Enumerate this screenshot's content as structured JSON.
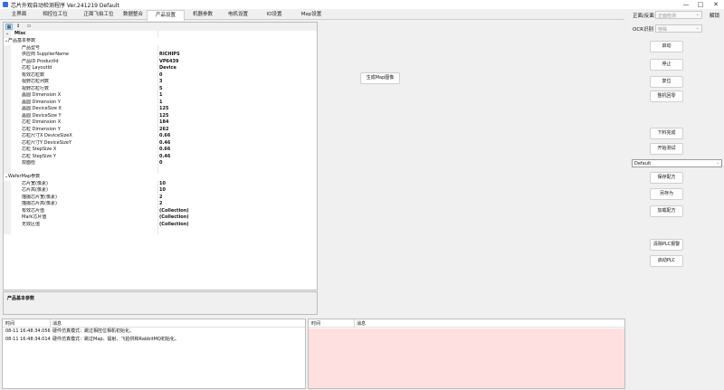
{
  "window": {
    "title": "芯片外观自动检测程序 Ver.241219 Default",
    "controls": [
      "—",
      "□",
      "✕"
    ]
  },
  "tabs": [
    "主界面",
    "相控位工位",
    "正面飞拍工位",
    "数据整合",
    "产品设置",
    "机器参数",
    "电机设置",
    "IO设置",
    "Map设置"
  ],
  "active_tab": "产品设置",
  "right_panel": {
    "mode_label": "正面/反面",
    "mode_value": "正面检测",
    "ocr_label": "OCR识别",
    "ocr_value": "特殊",
    "lock_label": "解锁",
    "buttons_top": [
      "启动",
      "停止",
      "复位",
      "整机回零"
    ],
    "buttons_mid": [
      "下料完成",
      "开始测试"
    ],
    "recipe_value": "Default",
    "buttons_recipe": [
      "保存配方",
      "另存为",
      "加载配方"
    ],
    "buttons_plc": [
      "清除PLC报警",
      "启动PLC"
    ]
  },
  "grid": {
    "toolbar": [
      "categorized-icon",
      "alphabetical-icon",
      "property-pages-icon"
    ],
    "root": "Misc",
    "sections": [
      {
        "title": "产品基本参数",
        "rows": [
          {
            "name": "产品型号",
            "value": ""
          },
          {
            "name": "供应商 SupplierName",
            "value": "RICHIPS"
          },
          {
            "name": "产品ID ProductId",
            "value": "VP6439"
          },
          {
            "name": "芯粒 LayoutId",
            "value": "Device"
          },
          {
            "name": "有效芯粒数",
            "value": "0"
          },
          {
            "name": "视野芯粒列数",
            "value": "3"
          },
          {
            "name": "视野芯粒行数",
            "value": "5"
          },
          {
            "name": "晶圆 Dimension X",
            "value": "1"
          },
          {
            "name": "晶圆 Dimension Y",
            "value": "1"
          },
          {
            "name": "晶圆 DeviceSize X",
            "value": "125"
          },
          {
            "name": "晶圆 DeviceSize Y",
            "value": "125"
          },
          {
            "name": "芯粒 Dimension X",
            "value": "184"
          },
          {
            "name": "芯粒 Dimension Y",
            "value": "262"
          },
          {
            "name": "芯粒尺寸X DeviceSizeX",
            "value": "0.66"
          },
          {
            "name": "芯粒尺寸Y DeviceSizeY",
            "value": "0.46"
          },
          {
            "name": "芯粒 StepSize X",
            "value": "0.66"
          },
          {
            "name": "芯粒 StepSize Y",
            "value": "0.46"
          },
          {
            "name": "双面检",
            "value": "0"
          }
        ]
      },
      {
        "title": "WaferMap参数",
        "rows": [
          {
            "name": "芯片宽(像素)",
            "value": "10"
          },
          {
            "name": "芯片高(像素)",
            "value": "10"
          },
          {
            "name": "描摄芯片宽(像素)",
            "value": "2"
          },
          {
            "name": "描摄芯片高(像素)",
            "value": "2"
          },
          {
            "name": "有效芯片值",
            "value": "(Collection)"
          },
          {
            "name": "Mark芯片值",
            "value": "(Collection)"
          },
          {
            "name": "无效区值",
            "value": "(Collection)"
          }
        ]
      }
    ],
    "help_title": "产品基本参数"
  },
  "center_button": "生成Map图像",
  "log_left": {
    "headers": [
      "时间",
      "消息"
    ],
    "rows": [
      {
        "time": "08-11 16:48:34.056",
        "msg": "硬件仿真模式：跳过相控位相机初始化。"
      },
      {
        "time": "08-11 16:48:34.014",
        "msg": "硬件仿真模式：跳过Map、镭射、飞拍供和RabbitMQ初始化。"
      }
    ]
  },
  "log_right": {
    "headers": [
      "时间",
      "消息"
    ],
    "bg_color": "#ffe0e0"
  }
}
